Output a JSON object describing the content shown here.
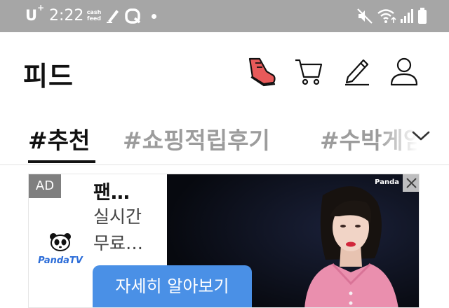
{
  "status_bar": {
    "carrier": "U",
    "carrier_sup": "+",
    "time": "2:22",
    "cashfeed_line1": "cash",
    "cashfeed_line2": "feed"
  },
  "header": {
    "title": "피드"
  },
  "tabs": [
    {
      "label": "#추천",
      "active": true
    },
    {
      "label": "#쇼핑적립후기",
      "active": false
    },
    {
      "label": "#수박게임",
      "active": false
    }
  ],
  "ad": {
    "label": "AD",
    "title": "팬…",
    "description": "실시간\n무료…",
    "cta": "자세히 알아보기",
    "brand": "PandaTV",
    "watermark": "Panda"
  },
  "colors": {
    "status_bar": "#a6a6a6",
    "cta": "#4a90e6",
    "ad_label_bg": "#7f7f7f",
    "shoe_accent": "#e85a5a"
  },
  "icons": [
    "shoe-icon",
    "cart-icon",
    "pencil-icon",
    "user-icon",
    "chevron-down-icon",
    "close-icon",
    "mute-icon",
    "wifi-icon",
    "signal-icon",
    "battery-icon"
  ]
}
